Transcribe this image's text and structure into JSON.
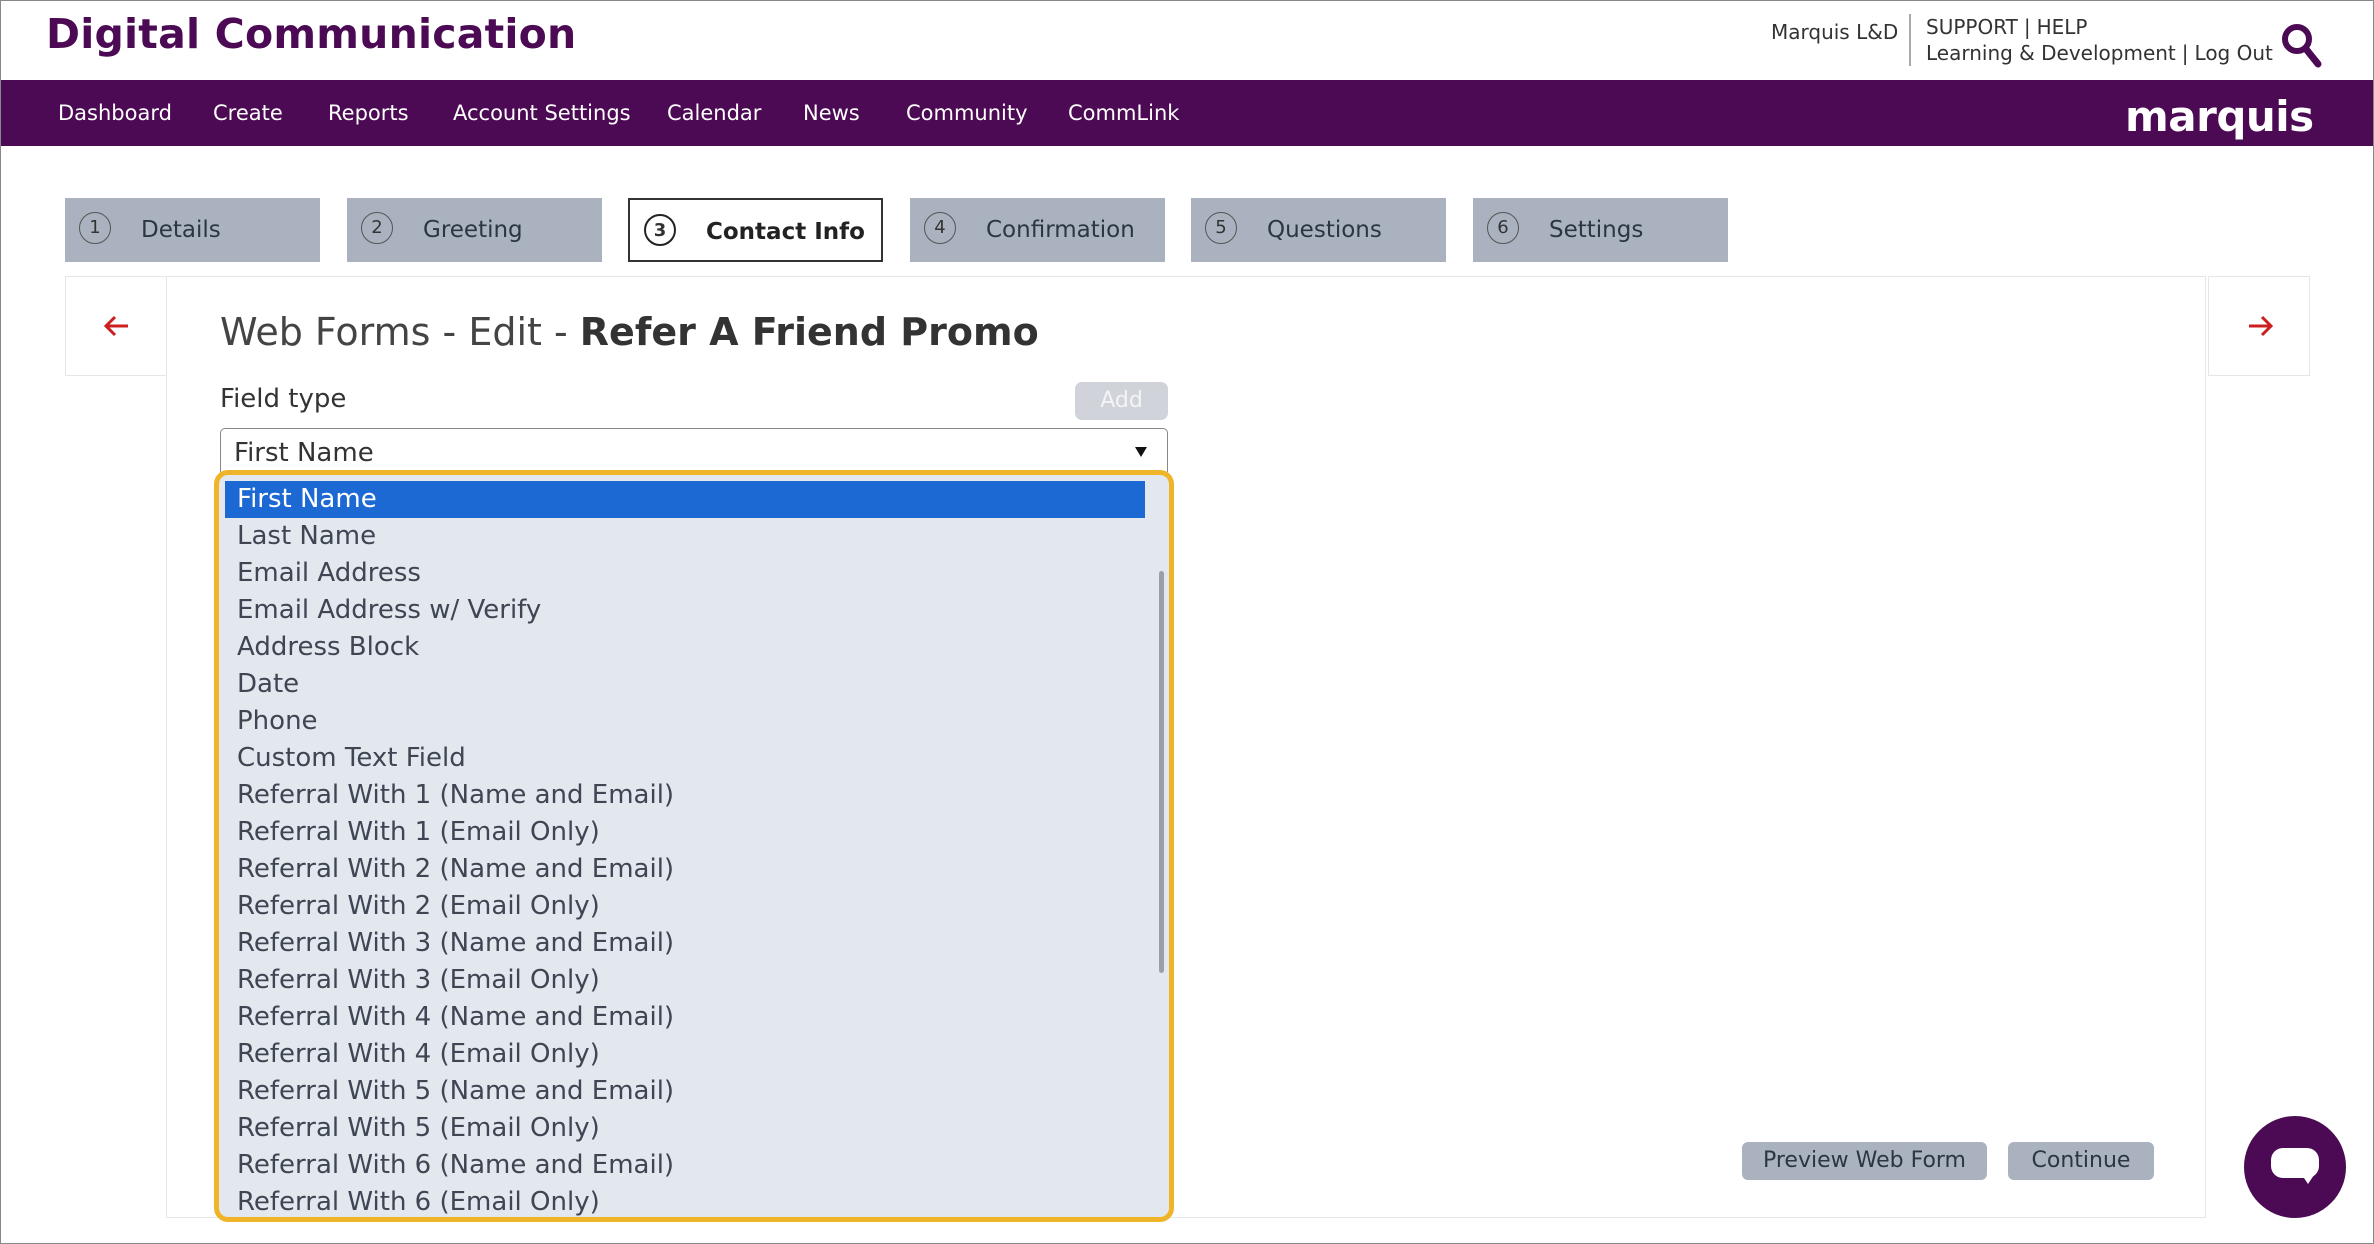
{
  "header": {
    "app_title": "Digital Communication",
    "org_name": "Marquis L&D",
    "support": "SUPPORT",
    "help": "HELP",
    "org_long": "Learning & Development",
    "logout": "Log Out",
    "search_icon": "search-icon"
  },
  "nav": {
    "items": [
      "Dashboard",
      "Create",
      "Reports",
      "Account Settings",
      "Calendar",
      "News",
      "Community",
      "CommLink"
    ],
    "brand": "marquis"
  },
  "steps": [
    {
      "num": "1",
      "label": "Details"
    },
    {
      "num": "2",
      "label": "Greeting"
    },
    {
      "num": "3",
      "label": "Contact Info"
    },
    {
      "num": "4",
      "label": "Confirmation"
    },
    {
      "num": "5",
      "label": "Questions"
    },
    {
      "num": "6",
      "label": "Settings"
    }
  ],
  "active_step": "3",
  "page": {
    "title_prefix": "Web Forms - Edit - ",
    "title_name": "Refer A Friend Promo"
  },
  "form": {
    "field_label": "Field type",
    "add_label": "Add",
    "selected": "First Name",
    "options": [
      "First Name",
      "Last Name",
      "Email Address",
      "Email Address w/ Verify",
      "Address Block",
      "Date",
      "Phone",
      "Custom Text Field",
      "Referral With 1 (Name and Email)",
      "Referral With 1 (Email Only)",
      "Referral With 2 (Name and Email)",
      "Referral With 2 (Email Only)",
      "Referral With 3 (Name and Email)",
      "Referral With 3 (Email Only)",
      "Referral With 4 (Name and Email)",
      "Referral With 4 (Email Only)",
      "Referral With 5 (Name and Email)",
      "Referral With 5 (Email Only)",
      "Referral With 6 (Name and Email)",
      "Referral With 6 (Email Only)"
    ]
  },
  "actions": {
    "preview": "Preview Web Form",
    "continue": "Continue"
  },
  "colors": {
    "brand_purple": "#4b0a53",
    "selection_blue": "#1c69d4",
    "focus_gold": "#f0b429",
    "arrow_red": "#cc1f1f"
  }
}
